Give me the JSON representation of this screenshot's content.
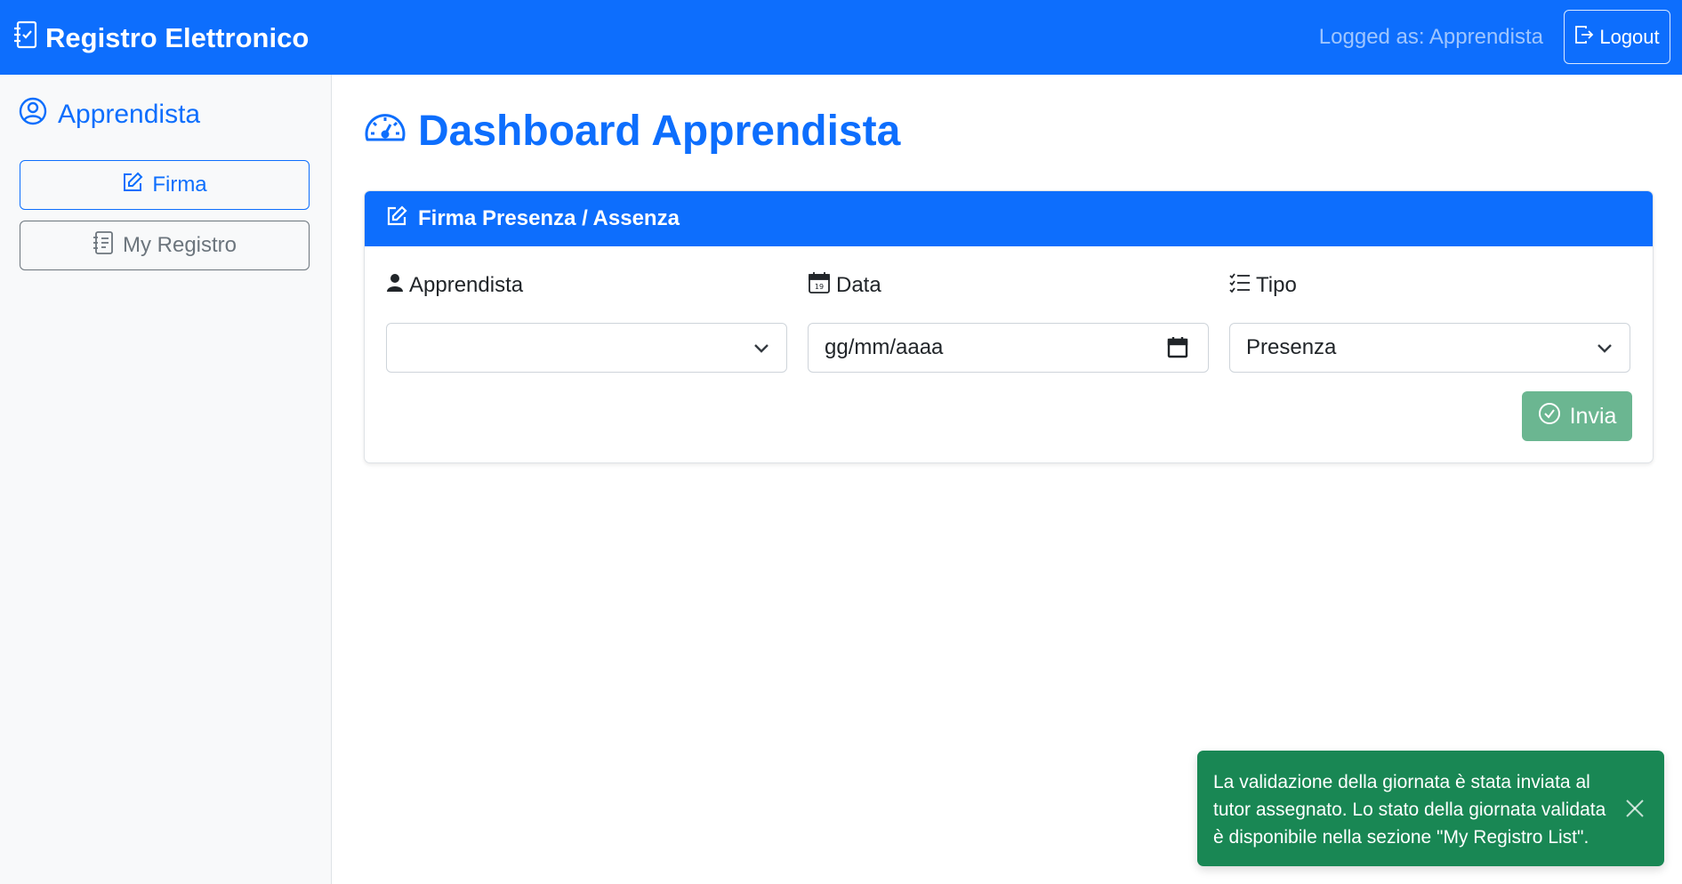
{
  "navbar": {
    "brand": "Registro Elettronico",
    "brand_icon": "journal-check-icon",
    "logged_as": "Logged as: Apprendista",
    "logout_label": "Logout",
    "logout_icon": "box-arrow-right-icon",
    "background": "#0d6efd"
  },
  "sidebar": {
    "title": "Apprendista",
    "title_icon": "person-circle-icon",
    "items": [
      {
        "label": "Firma",
        "icon": "pencil-square-icon",
        "style": "primary"
      },
      {
        "label": "My Registro",
        "icon": "journal-text-icon",
        "style": "secondary"
      }
    ]
  },
  "main": {
    "title": "Dashboard Apprendista",
    "title_icon": "speedometer-icon",
    "card": {
      "header": "Firma Presenza / Assenza",
      "header_icon": "pencil-square-icon",
      "fields": {
        "apprendista": {
          "label": "Apprendista",
          "icon": "person-icon",
          "value": ""
        },
        "data": {
          "label": "Data",
          "icon": "calendar-icon",
          "placeholder": "gg/mm/aaaa"
        },
        "tipo": {
          "label": "Tipo",
          "icon": "list-check-icon",
          "value": "Presenza"
        }
      },
      "submit_label": "Invia",
      "submit_icon": "check-circle-icon",
      "submit_color": "#6bb691"
    }
  },
  "toast": {
    "message": "La validazione della giornata è stata inviata al tutor assegnato. Lo stato della giornata validata è disponibile nella sezione \"My Registro List\".",
    "background": "#198754",
    "close_icon": "close-icon"
  }
}
